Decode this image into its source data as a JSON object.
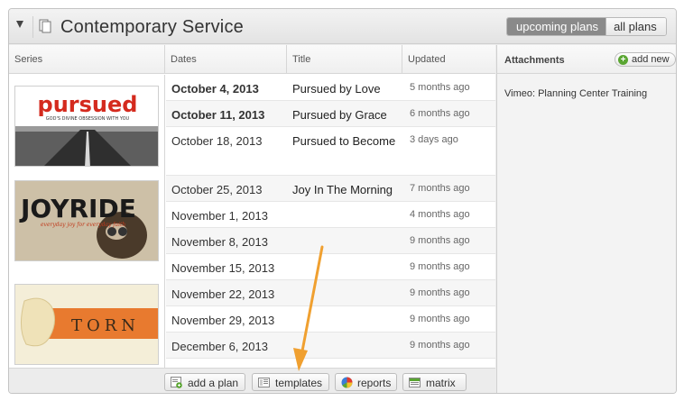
{
  "header": {
    "title": "Contemporary Service",
    "upcoming_label": "upcoming plans",
    "all_label": "all plans"
  },
  "columns": {
    "series": "Series",
    "dates": "Dates",
    "title": "Title",
    "updated": "Updated"
  },
  "series_thumbs": [
    {
      "name": "pursued",
      "tagline": "GOD'S DIVINE OBSESSION WITH YOU"
    },
    {
      "name": "JOYRIDE",
      "tagline": "everyday joy for everyday faith"
    },
    {
      "name": "TORN"
    }
  ],
  "plans": [
    {
      "date": "October 4, 2013",
      "title": "Pursued by Love",
      "updated": "5 months ago"
    },
    {
      "date": "October 11, 2013",
      "title": "Pursued by Grace",
      "updated": "6 months ago"
    },
    {
      "date": "October 18, 2013",
      "title": "Pursued to Become",
      "updated": "3 days ago"
    },
    {
      "date": "October 25, 2013",
      "title": "Joy In The Morning",
      "updated": "7 months ago"
    },
    {
      "date": "November 1, 2013",
      "title": "",
      "updated": "4 months ago"
    },
    {
      "date": "November 8, 2013",
      "title": "",
      "updated": "9 months ago"
    },
    {
      "date": "November 15, 2013",
      "title": "",
      "updated": "9 months ago"
    },
    {
      "date": "November 22, 2013",
      "title": "",
      "updated": "9 months ago"
    },
    {
      "date": "November 29, 2013",
      "title": "",
      "updated": "9 months ago"
    },
    {
      "date": "December 6, 2013",
      "title": "",
      "updated": "9 months ago"
    }
  ],
  "footer": {
    "add_plan": "add a plan",
    "templates": "templates",
    "reports": "reports",
    "matrix": "matrix"
  },
  "attachments": {
    "heading": "Attachments",
    "add_new": "add new",
    "items": [
      "Vimeo: Planning Center Training"
    ]
  },
  "colors": {
    "arrow": "#f0a030",
    "add_green": "#5aa632",
    "segment_active": "#8a8a8a"
  }
}
